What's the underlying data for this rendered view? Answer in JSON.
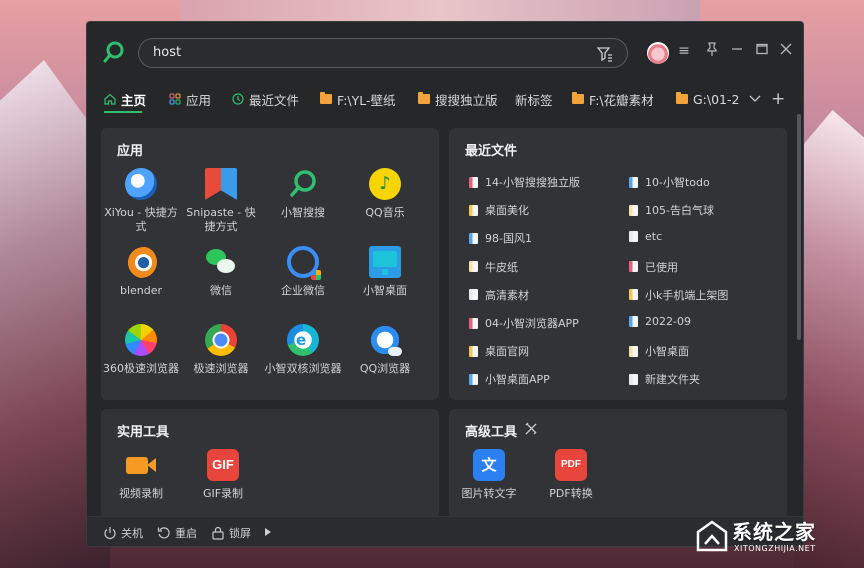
{
  "search": {
    "value": "host"
  },
  "tabs": [
    {
      "label": "主页",
      "icon": "home-icon"
    },
    {
      "label": "应用",
      "icon": "apps-grid-icon"
    },
    {
      "label": "最近文件",
      "icon": "clock-icon"
    },
    {
      "label": "F:\\YL-壁纸",
      "icon": "folder-icon"
    },
    {
      "label": "搜搜独立版",
      "icon": "folder-icon"
    },
    {
      "label": "新标签",
      "icon": ""
    },
    {
      "label": "F:\\花瓣素材",
      "icon": "folder-icon"
    },
    {
      "label": "G:\\01-2",
      "icon": "folder-icon"
    }
  ],
  "apps_panel": {
    "title": "应用",
    "items": [
      {
        "label": "XiYou - 快捷方式",
        "icon": "xiyou-icon"
      },
      {
        "label": "Snipaste - 快捷方式",
        "icon": "snipaste-icon"
      },
      {
        "label": "小智搜搜",
        "icon": "search-app-icon"
      },
      {
        "label": "QQ音乐",
        "icon": "qq-music-icon"
      },
      {
        "label": "blender",
        "icon": "blender-icon"
      },
      {
        "label": "微信",
        "icon": "wechat-icon"
      },
      {
        "label": "企业微信",
        "icon": "wecom-icon"
      },
      {
        "label": "小智桌面",
        "icon": "desktop-app-icon"
      },
      {
        "label": "360极速浏览器",
        "icon": "360-browser-icon"
      },
      {
        "label": "极速浏览器",
        "icon": "chrome-icon"
      },
      {
        "label": "小智双核浏览器",
        "icon": "dual-core-browser-icon"
      },
      {
        "label": "QQ浏览器",
        "icon": "qq-browser-icon"
      }
    ]
  },
  "recent_panel": {
    "title": "最近文件",
    "left": [
      "14-小智搜搜独立版",
      "桌面美化",
      "98-国风1",
      "牛皮纸",
      "高清素材",
      "04-小智浏览器APP",
      "桌面官网",
      "小智桌面APP"
    ],
    "right": [
      "10-小智todo",
      "105-告白气球",
      "etc",
      "已使用",
      "小k手机端上架图",
      "2022-09",
      "小智桌面",
      "新建文件夹"
    ]
  },
  "tools_panel": {
    "title": "实用工具",
    "items": [
      {
        "label": "视频录制",
        "icon": "video-record-icon"
      },
      {
        "label": "GIF录制",
        "icon": "gif-record-icon",
        "badge": "GIF"
      }
    ]
  },
  "adv_panel": {
    "title": "高级工具",
    "items": [
      {
        "label": "图片转文字",
        "icon": "ocr-icon",
        "badge": "文"
      },
      {
        "label": "PDF转换",
        "icon": "pdf-icon",
        "badge": "PDF"
      }
    ]
  },
  "bottom": {
    "shutdown": "关机",
    "restart": "重启",
    "lock": "锁屏"
  },
  "watermark": {
    "text": "系统之家",
    "sub": "XITONGZHIJIA.NET"
  },
  "colors": {
    "accent": "#2fbf6f",
    "folder": "#f2a33a",
    "panel": "#313337",
    "window": "#252729"
  }
}
